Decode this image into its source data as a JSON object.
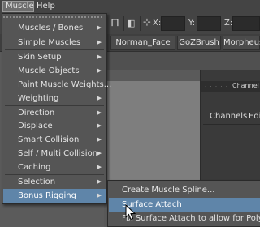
{
  "menubar": {
    "items": [
      {
        "label": "Muscle"
      },
      {
        "label": "Help"
      }
    ]
  },
  "toolbar": {
    "field_labels": [
      "X:",
      "Y:",
      "Z:"
    ]
  },
  "shelf_tabs": [
    {
      "label": "Norman_Face"
    },
    {
      "label": "GoZBrush"
    },
    {
      "label": "Morpheus"
    }
  ],
  "channel_box": {
    "title": "Channel B",
    "tabs": [
      {
        "label": "Channels"
      },
      {
        "label": "Editi"
      }
    ]
  },
  "muscle_menu": {
    "items": [
      {
        "label": "Muscles / Bones",
        "has_submenu": true
      },
      {
        "label": "Simple Muscles",
        "has_submenu": true
      },
      {
        "label": "Skin Setup",
        "has_submenu": true
      },
      {
        "label": "Muscle Objects",
        "has_submenu": true
      },
      {
        "label": "Paint Muscle Weights...",
        "has_submenu": false
      },
      {
        "label": "Weighting",
        "has_submenu": true
      },
      {
        "label": "Direction",
        "has_submenu": true
      },
      {
        "label": "Displace",
        "has_submenu": true
      },
      {
        "label": "Smart Collision",
        "has_submenu": true
      },
      {
        "label": "Self / Multi Collision",
        "has_submenu": true
      },
      {
        "label": "Caching",
        "has_submenu": true
      },
      {
        "label": "Selection",
        "has_submenu": true
      },
      {
        "label": "Bonus Rigging",
        "has_submenu": true,
        "active": true
      }
    ],
    "submenu_arrow": "▶"
  },
  "bonus_rigging_submenu": {
    "items": [
      {
        "label": "Create Muscle Spline..."
      },
      {
        "label": "Surface Attach",
        "active": true
      },
      {
        "label": "Fix Surface Attach to allow for Poly Smooth"
      }
    ]
  },
  "colors": {
    "menu_bg": "#555555",
    "highlight": "#5f85a9",
    "menubar_bg": "#444444",
    "text": "#e4e4e4"
  },
  "icons": [
    "cursor-arrow-icon",
    "submenu-arrow-icon",
    "tear-off-icon"
  ]
}
